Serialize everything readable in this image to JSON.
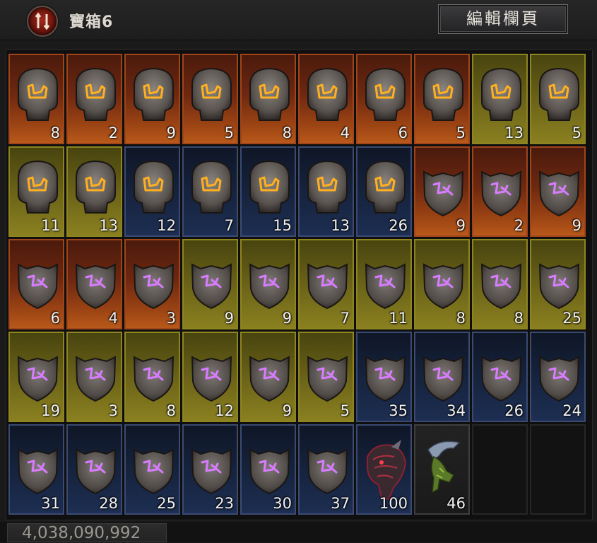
{
  "header": {
    "title": "寶箱6",
    "edit_label": "編輯欄頁"
  },
  "colors": {
    "orange": "#9c4414",
    "yellow": "#8a8020",
    "blue": "#1d2e52",
    "rune_glow_orange": "#ffb020",
    "rune_glow_purple": "#d87cff"
  },
  "grid": {
    "rows": [
      [
        {
          "bg": "orange",
          "item": "rune-stone-orange",
          "qty": "8"
        },
        {
          "bg": "orange",
          "item": "rune-stone-orange",
          "qty": "2"
        },
        {
          "bg": "orange",
          "item": "rune-stone-orange",
          "qty": "9"
        },
        {
          "bg": "orange",
          "item": "rune-stone-orange",
          "qty": "5"
        },
        {
          "bg": "orange",
          "item": "rune-stone-orange",
          "qty": "8"
        },
        {
          "bg": "orange",
          "item": "rune-stone-orange",
          "qty": "4"
        },
        {
          "bg": "orange",
          "item": "rune-stone-orange",
          "qty": "6"
        },
        {
          "bg": "orange",
          "item": "rune-stone-orange",
          "qty": "5"
        },
        {
          "bg": "yellow",
          "item": "rune-stone-orange",
          "qty": "13"
        },
        {
          "bg": "yellow",
          "item": "rune-stone-orange",
          "qty": "5"
        }
      ],
      [
        {
          "bg": "yellow",
          "item": "rune-stone-orange",
          "qty": "11"
        },
        {
          "bg": "yellow",
          "item": "rune-stone-orange",
          "qty": "13"
        },
        {
          "bg": "blue",
          "item": "rune-stone-orange",
          "qty": "12"
        },
        {
          "bg": "blue",
          "item": "rune-stone-orange",
          "qty": "7"
        },
        {
          "bg": "blue",
          "item": "rune-stone-orange",
          "qty": "15"
        },
        {
          "bg": "blue",
          "item": "rune-stone-orange",
          "qty": "13"
        },
        {
          "bg": "blue",
          "item": "rune-stone-orange",
          "qty": "26"
        },
        {
          "bg": "orange",
          "item": "rune-shield-purple",
          "qty": "9"
        },
        {
          "bg": "orange",
          "item": "rune-shield-purple",
          "qty": "2"
        },
        {
          "bg": "orange",
          "item": "rune-shield-purple",
          "qty": "9"
        }
      ],
      [
        {
          "bg": "orange",
          "item": "rune-shield-purple",
          "qty": "6"
        },
        {
          "bg": "orange",
          "item": "rune-shield-purple",
          "qty": "4"
        },
        {
          "bg": "orange",
          "item": "rune-shield-purple",
          "qty": "3"
        },
        {
          "bg": "yellow",
          "item": "rune-shield-purple",
          "qty": "9"
        },
        {
          "bg": "yellow",
          "item": "rune-shield-purple",
          "qty": "9"
        },
        {
          "bg": "yellow",
          "item": "rune-shield-purple",
          "qty": "7"
        },
        {
          "bg": "yellow",
          "item": "rune-shield-purple",
          "qty": "11"
        },
        {
          "bg": "yellow",
          "item": "rune-shield-purple",
          "qty": "8"
        },
        {
          "bg": "yellow",
          "item": "rune-shield-purple",
          "qty": "8"
        },
        {
          "bg": "yellow",
          "item": "rune-shield-purple",
          "qty": "25"
        }
      ],
      [
        {
          "bg": "yellow",
          "item": "rune-shield-purple",
          "qty": "19"
        },
        {
          "bg": "yellow",
          "item": "rune-shield-purple",
          "qty": "3"
        },
        {
          "bg": "yellow",
          "item": "rune-shield-purple",
          "qty": "8"
        },
        {
          "bg": "yellow",
          "item": "rune-shield-purple",
          "qty": "12"
        },
        {
          "bg": "yellow",
          "item": "rune-shield-purple",
          "qty": "9"
        },
        {
          "bg": "yellow",
          "item": "rune-shield-purple",
          "qty": "5"
        },
        {
          "bg": "blue",
          "item": "rune-shield-purple",
          "qty": "35"
        },
        {
          "bg": "blue",
          "item": "rune-shield-purple",
          "qty": "34"
        },
        {
          "bg": "blue",
          "item": "rune-shield-purple",
          "qty": "26"
        },
        {
          "bg": "blue",
          "item": "rune-shield-purple",
          "qty": "24"
        }
      ],
      [
        {
          "bg": "blue",
          "item": "rune-shield-purple",
          "qty": "31"
        },
        {
          "bg": "blue",
          "item": "rune-shield-purple",
          "qty": "28"
        },
        {
          "bg": "blue",
          "item": "rune-shield-purple",
          "qty": "25"
        },
        {
          "bg": "blue",
          "item": "rune-shield-purple",
          "qty": "23"
        },
        {
          "bg": "blue",
          "item": "rune-shield-purple",
          "qty": "30"
        },
        {
          "bg": "blue",
          "item": "rune-shield-purple",
          "qty": "37"
        },
        {
          "bg": "blue",
          "item": "demon-hand-material",
          "qty": "100"
        },
        {
          "bg": "dark",
          "item": "beast-claw-material",
          "qty": "46"
        },
        {
          "bg": "empty",
          "item": "",
          "qty": ""
        },
        {
          "bg": "empty",
          "item": "",
          "qty": ""
        }
      ]
    ]
  },
  "footer": {
    "gold": "4,038,090,992"
  }
}
